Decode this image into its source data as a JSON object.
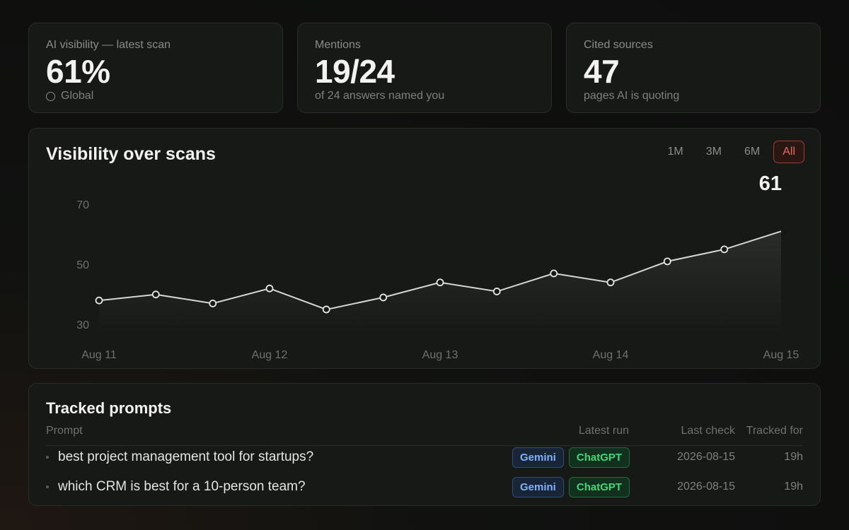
{
  "stats": [
    {
      "label": "AI visibility — latest scan",
      "value": "61%",
      "sub": "Global"
    },
    {
      "label": "Mentions",
      "value": "19/24",
      "sub": "of 24 answers named you"
    },
    {
      "label": "Cited sources",
      "value": "47",
      "sub": "pages AI is quoting"
    }
  ],
  "chart": {
    "title": "Visibility over scans",
    "ranges": [
      "1M",
      "3M",
      "6M",
      "All"
    ],
    "active_range": "All",
    "latest_value": "61"
  },
  "chart_data": {
    "type": "area",
    "title": "Visibility over scans",
    "xlabel": "",
    "ylabel": "",
    "x_ticks": [
      "Aug 11",
      "Aug 12",
      "Aug 13",
      "Aug 14",
      "Aug 15"
    ],
    "y_ticks": [
      30,
      50,
      70
    ],
    "x_range_days": [
      0,
      4
    ],
    "ylim": [
      27,
      74
    ],
    "grid": false,
    "series": [
      {
        "points": [
          {
            "x": 0,
            "y": 38
          },
          {
            "x": 0.333,
            "y": 40
          },
          {
            "x": 0.667,
            "y": 37
          },
          {
            "x": 1,
            "y": 42
          },
          {
            "x": 1.333,
            "y": 35
          },
          {
            "x": 1.667,
            "y": 39
          },
          {
            "x": 2,
            "y": 44
          },
          {
            "x": 2.333,
            "y": 41
          },
          {
            "x": 2.667,
            "y": 47
          },
          {
            "x": 3,
            "y": 44
          },
          {
            "x": 3.333,
            "y": 51
          },
          {
            "x": 3.667,
            "y": 55
          },
          {
            "x": 4,
            "y": 61
          }
        ]
      }
    ]
  },
  "prompts": {
    "title": "Tracked prompts",
    "headers": {
      "prompt": "Prompt",
      "latest_run": "Latest run",
      "last_check": "Last check",
      "tracked_for": "Tracked for"
    },
    "rows": [
      {
        "prompt": "best project management tool for startups?",
        "badges": [
          "Gemini",
          "ChatGPT"
        ],
        "last_check": "2026-08-15",
        "tracked_for": "19h"
      },
      {
        "prompt": "which CRM is best for a 10-person team?",
        "badges": [
          "Gemini",
          "ChatGPT"
        ],
        "last_check": "2026-08-15",
        "tracked_for": "19h"
      }
    ]
  }
}
